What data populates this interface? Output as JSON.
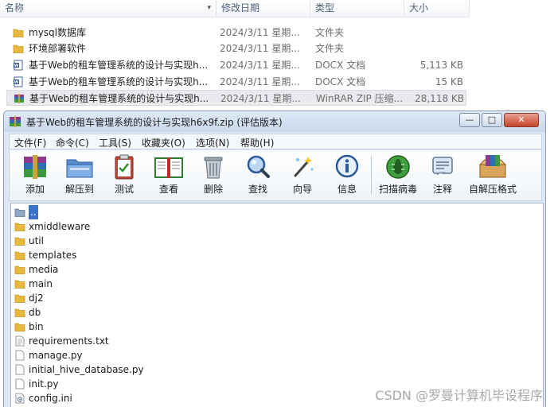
{
  "explorer": {
    "columns": {
      "name": "名称",
      "date": "修改日期",
      "type": "类型",
      "size": "大小"
    },
    "rows": [
      {
        "icon": "folder-icon",
        "name": "mysql数据库",
        "date": "2024/3/11 星期...",
        "type": "文件夹",
        "size": ""
      },
      {
        "icon": "folder-icon",
        "name": "环境部署软件",
        "date": "2024/3/11 星期...",
        "type": "文件夹",
        "size": ""
      },
      {
        "icon": "word-doc-icon",
        "name": "基于Web的租车管理系统的设计与实现h...",
        "date": "2024/3/11 星期...",
        "type": "DOCX 文档",
        "size": "5,113 KB"
      },
      {
        "icon": "word-doc-icon",
        "name": "基于Web的租车管理系统的设计与实现h...",
        "date": "2024/3/11 星期...",
        "type": "DOCX 文档",
        "size": "15 KB"
      },
      {
        "icon": "winrar-archive-icon",
        "name": "基于Web的租车管理系统的设计与实现h...",
        "date": "2024/3/11 星期...",
        "type": "WinRAR ZIP 压缩...",
        "size": "28,118 KB"
      }
    ]
  },
  "winrar": {
    "title": "基于Web的租车管理系统的设计与实现h6x9f.zip (评估版本)",
    "window_buttons": {
      "minimize": "—",
      "maximize": "□",
      "close": "✕"
    },
    "menu": [
      "文件(F)",
      "命令(C)",
      "工具(S)",
      "收藏夹(O)",
      "选项(N)",
      "帮助(H)"
    ],
    "toolbar": [
      {
        "label": "添加",
        "icon": "add-books-icon"
      },
      {
        "label": "解压到",
        "icon": "extract-folder-icon"
      },
      {
        "label": "测试",
        "icon": "test-clipboard-icon"
      },
      {
        "label": "查看",
        "icon": "view-book-icon"
      },
      {
        "label": "删除",
        "icon": "delete-trash-icon"
      },
      {
        "label": "查找",
        "icon": "find-magnifier-icon"
      },
      {
        "label": "向导",
        "icon": "wizard-wand-icon"
      },
      {
        "label": "信息",
        "icon": "info-icon"
      },
      {
        "label": "扫描病毒",
        "icon": "virus-scan-bug-icon"
      },
      {
        "label": "注释",
        "icon": "comment-icon"
      },
      {
        "label": "自解压格式",
        "icon": "sfx-box-icon"
      }
    ],
    "files": [
      {
        "name": "..",
        "icon": "parent-folder-icon"
      },
      {
        "name": "xmiddleware",
        "icon": "folder-icon"
      },
      {
        "name": "util",
        "icon": "folder-icon"
      },
      {
        "name": "templates",
        "icon": "folder-icon"
      },
      {
        "name": "media",
        "icon": "folder-icon"
      },
      {
        "name": "main",
        "icon": "folder-icon"
      },
      {
        "name": "dj2",
        "icon": "folder-icon"
      },
      {
        "name": "db",
        "icon": "folder-icon"
      },
      {
        "name": "bin",
        "icon": "folder-icon"
      },
      {
        "name": "requirements.txt",
        "icon": "text-file-icon"
      },
      {
        "name": "manage.py",
        "icon": "file-icon"
      },
      {
        "name": "initial_hive_database.py",
        "icon": "file-icon"
      },
      {
        "name": "init.py",
        "icon": "file-icon"
      },
      {
        "name": "config.ini",
        "icon": "settings-file-icon"
      }
    ]
  },
  "watermark": "CSDN @罗曼计算机毕设程序",
  "colors": {
    "selection": "#3d73c7",
    "folder": "#e8b93d",
    "window_frame": "#dde8f4"
  }
}
